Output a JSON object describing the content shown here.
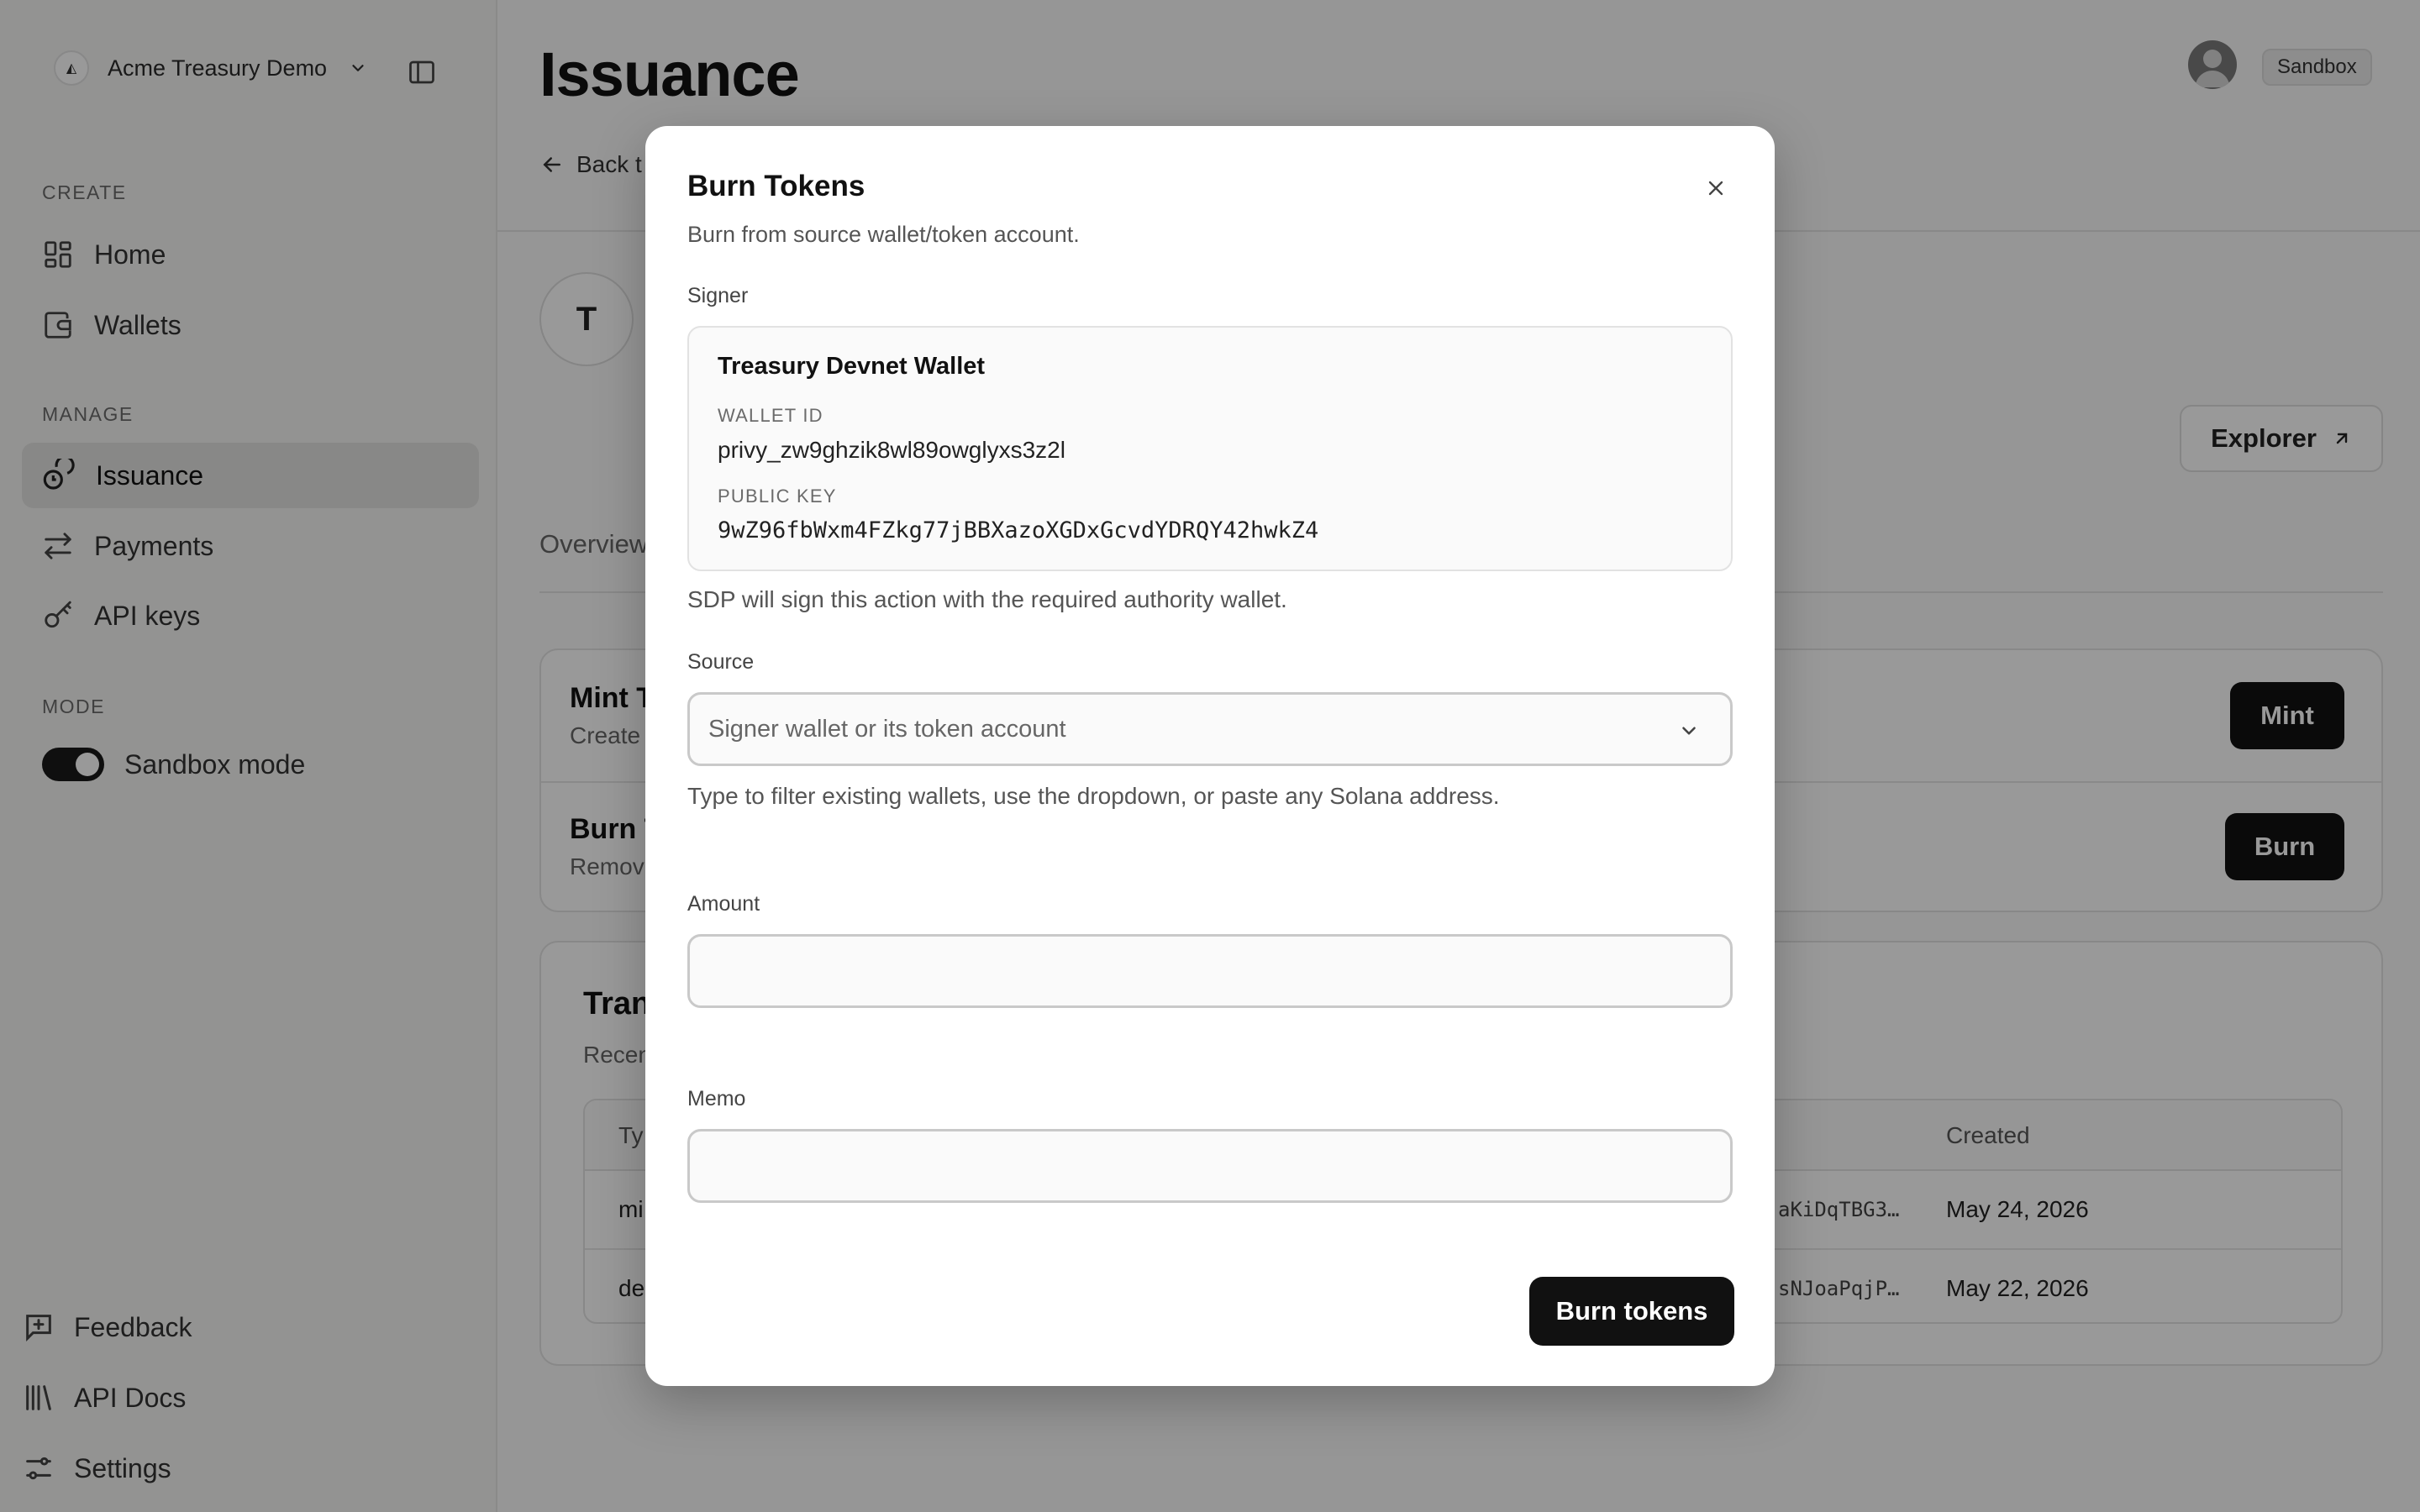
{
  "sidebar": {
    "workspace": {
      "logo_glyph": "◭",
      "name": "Acme Treasury Demo"
    },
    "sections": {
      "create": "CREATE",
      "manage": "MANAGE",
      "mode": "MODE"
    },
    "items": {
      "home": "Home",
      "wallets": "Wallets",
      "issuance": "Issuance",
      "payments": "Payments",
      "api_keys": "API keys"
    },
    "mode": {
      "label": "Sandbox mode",
      "enabled": true
    },
    "footer": {
      "feedback": "Feedback",
      "api_docs": "API Docs",
      "settings": "Settings"
    }
  },
  "header": {
    "title": "Issuance",
    "env_badge": "Sandbox",
    "back_link": "Back t"
  },
  "token": {
    "initial": "T",
    "explorer_label": "Explorer",
    "tab_visible": "Overview"
  },
  "actions": {
    "mint": {
      "title": "Mint T",
      "desc": "Create",
      "button": "Mint"
    },
    "burn": {
      "title": "Burn T",
      "desc": "Remov",
      "button": "Burn"
    }
  },
  "transactions": {
    "title": "Tran",
    "desc": "Recen",
    "header_type": "Ty",
    "header_created": "Created",
    "rows": [
      {
        "type": "mi",
        "sig": "aKiDqTBG3…",
        "created": "May 24, 2026"
      },
      {
        "type": "de",
        "sig": "sNJoaPqjP…",
        "created": "May 22, 2026"
      }
    ]
  },
  "modal": {
    "title": "Burn Tokens",
    "subtitle": "Burn from source wallet/token account.",
    "signer": {
      "label": "Signer",
      "name": "Treasury Devnet Wallet",
      "wallet_id_label": "WALLET ID",
      "wallet_id": "privy_zw9ghzik8wl89owglyxs3z2l",
      "public_key_label": "PUBLIC KEY",
      "public_key": "9wZ96fbWxm4FZkg77jBBXazoXGDxGcvdYDRQY42hwkZ4",
      "helper": "SDP will sign this action with the required authority wallet."
    },
    "source": {
      "label": "Source",
      "placeholder": "Signer wallet or its token account",
      "helper": "Type to filter existing wallets, use the dropdown, or paste any Solana address."
    },
    "amount": {
      "label": "Amount",
      "value": ""
    },
    "memo": {
      "label": "Memo",
      "value": ""
    },
    "submit": "Burn tokens"
  },
  "colors": {
    "primary": "#111111",
    "overlay": "rgba(0,0,0,0.40)"
  }
}
